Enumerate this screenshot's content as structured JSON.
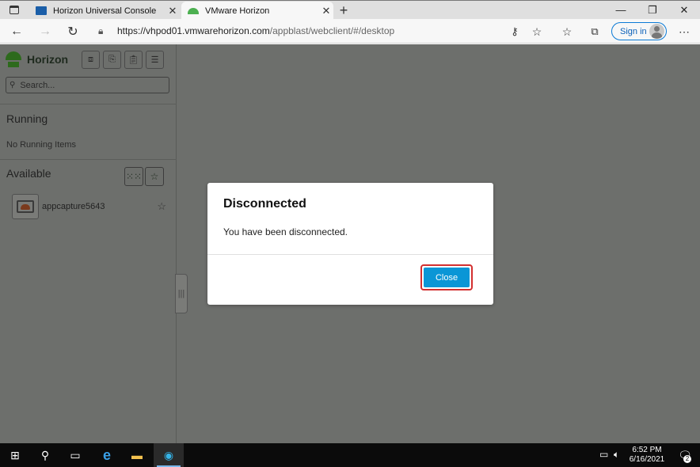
{
  "browser": {
    "tabs": [
      {
        "title": "Horizon Universal Console",
        "active": false
      },
      {
        "title": "VMware Horizon",
        "active": true
      }
    ],
    "url_main": "https://vhpod01.vmwarehorizon.com",
    "url_path": "/appblast/webclient/#/desktop",
    "sign_in_label": "Sign in"
  },
  "sidebar": {
    "brand": "Horizon",
    "search_placeholder": "Search...",
    "running_title": "Running",
    "running_empty": "No Running Items",
    "available_title": "Available",
    "apps": [
      {
        "name": "appcapture5643"
      }
    ]
  },
  "modal": {
    "title": "Disconnected",
    "message": "You have been disconnected.",
    "close_label": "Close"
  },
  "taskbar": {
    "time": "6:52 PM",
    "date": "6/16/2021",
    "notification_count": "2"
  },
  "colors": {
    "accent": "#0a96d6",
    "highlight_border": "#d32f2f",
    "overlay": "#6d6f6c",
    "horizon_green": "#2d6a1c"
  }
}
